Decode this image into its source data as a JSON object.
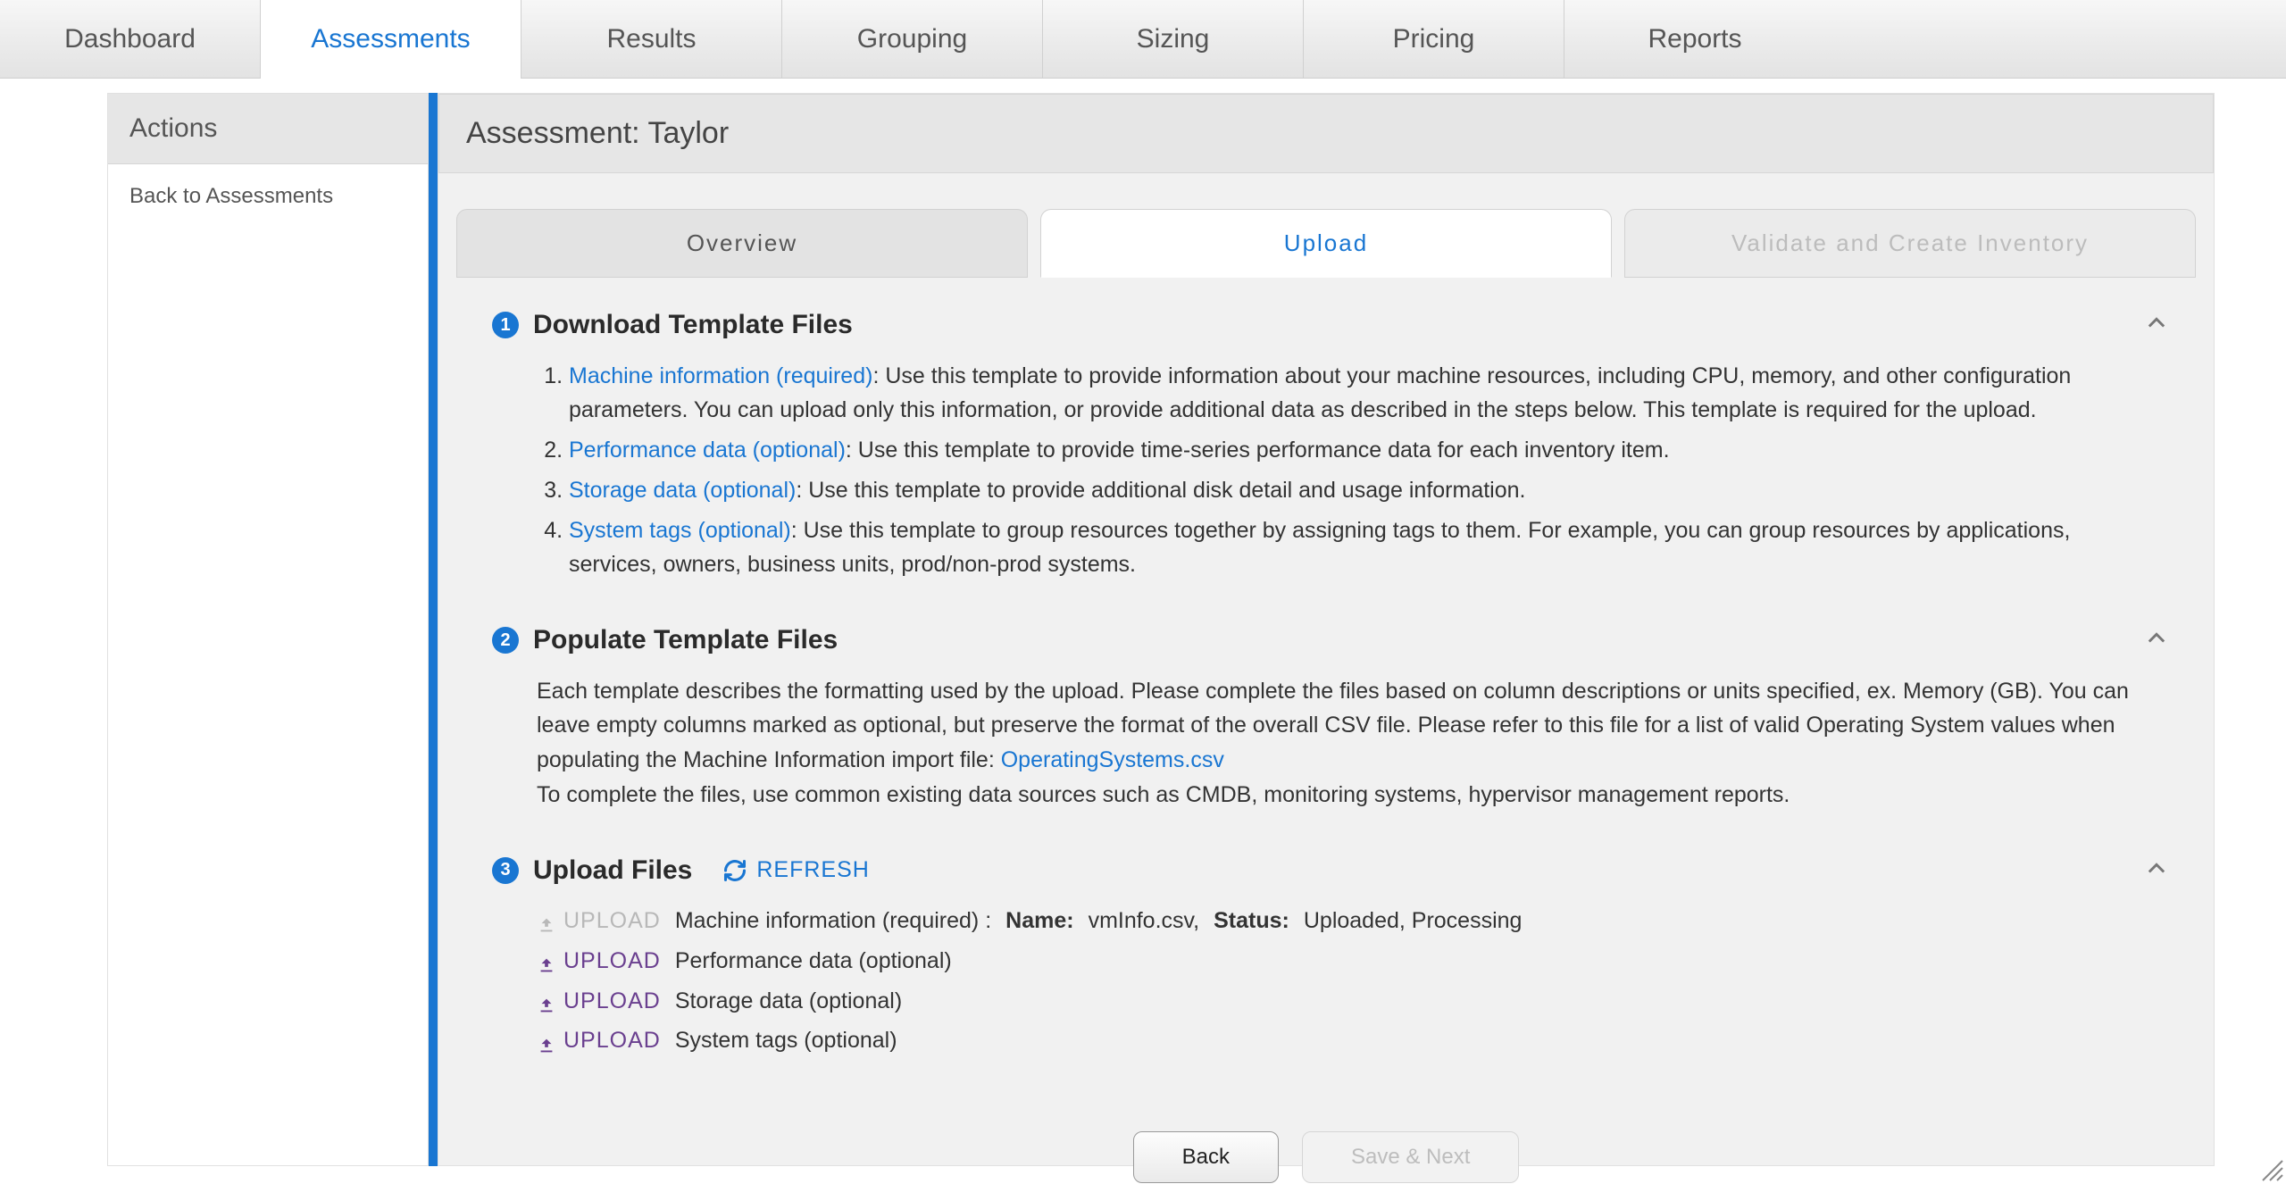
{
  "nav": {
    "tabs": [
      "Dashboard",
      "Assessments",
      "Results",
      "Grouping",
      "Sizing",
      "Pricing",
      "Reports"
    ],
    "active_index": 1
  },
  "sidebar": {
    "title": "Actions",
    "back_link": "Back to Assessments"
  },
  "page": {
    "title": "Assessment: Taylor"
  },
  "subtabs": {
    "items": [
      "Overview",
      "Upload",
      "Validate and Create Inventory"
    ],
    "active_index": 1,
    "disabled_indices": [
      2
    ]
  },
  "section1": {
    "num": "1",
    "title": "Download Template Files",
    "items": [
      {
        "link": "Machine information (required)",
        "text": ": Use this template to provide information about your machine resources, including CPU, memory, and other configuration parameters. You can upload only this information, or provide additional data as described in the steps below. This template is required for the upload."
      },
      {
        "link": "Performance data (optional)",
        "text": ": Use this template to provide time-series performance data for each inventory item."
      },
      {
        "link": "Storage data (optional)",
        "text": ": Use this template to provide additional disk detail and usage information."
      },
      {
        "link": "System tags (optional)",
        "text": ": Use this template to group resources together by assigning tags to them. For example, you can group resources by applications, services, owners, business units, prod/non-prod systems."
      }
    ]
  },
  "section2": {
    "num": "2",
    "title": "Populate Template Files",
    "body_pre": "Each template describes the formatting used by the upload. Please complete the files based on column descriptions or units specified, ex. Memory (GB). You can leave empty columns marked as optional, but preserve the format of the overall CSV file. Please refer to this file for a list of valid Operating System values when populating the Machine Information import file: ",
    "os_link": "OperatingSystems.csv",
    "body_post": "To complete the files, use common existing data sources such as CMDB, monitoring systems, hypervisor management reports."
  },
  "section3": {
    "num": "3",
    "title": "Upload Files",
    "refresh": "REFRESH",
    "upload_label": "UPLOAD",
    "rows": [
      {
        "enabled": false,
        "label": "Machine information (required) :",
        "name_label": "Name:",
        "name_value": "vmInfo.csv,",
        "status_label": "Status:",
        "status_value": "Uploaded, Processing"
      },
      {
        "enabled": true,
        "label": "Performance data (optional)"
      },
      {
        "enabled": true,
        "label": "Storage data (optional)"
      },
      {
        "enabled": true,
        "label": "System tags (optional)"
      }
    ]
  },
  "footer": {
    "back": "Back",
    "next": "Save & Next"
  }
}
